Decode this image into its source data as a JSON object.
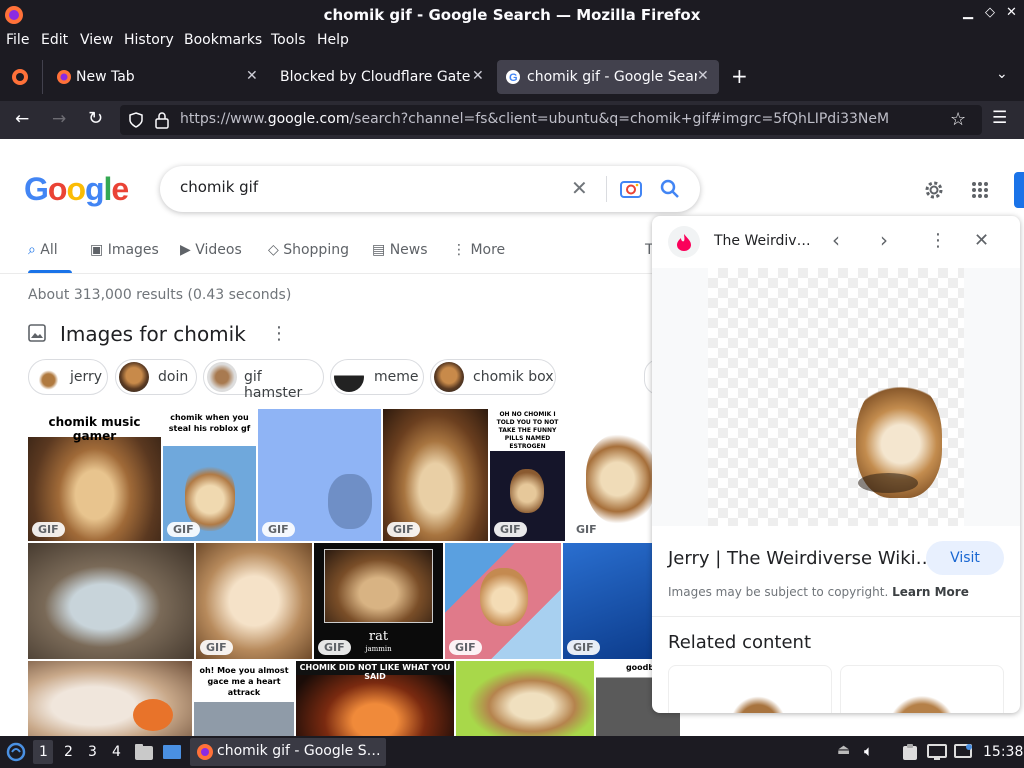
{
  "window": {
    "title": "chomik gif - Google Search — Mozilla Firefox"
  },
  "menu": [
    "File",
    "Edit",
    "View",
    "History",
    "Bookmarks",
    "Tools",
    "Help"
  ],
  "tabs": [
    {
      "label": "New Tab"
    },
    {
      "label": "Blocked by Cloudflare Gatew"
    },
    {
      "label": "chomik gif - Google Searc"
    }
  ],
  "url": {
    "scheme": "https://www.",
    "domain": "google.com",
    "path": "/search?channel=fs&client=ubuntu&q=chomik+gif#imgrc=5fQhLIPdi33NeM"
  },
  "google": {
    "logo": "Google",
    "query": "chomik gif",
    "tabs": [
      "All",
      "Images",
      "Videos",
      "Shopping",
      "News",
      "More"
    ],
    "extra_tab": "T",
    "result_stats": "About 313,000 results (0.43 seconds)",
    "images_heading": "Images for chomik",
    "chips": [
      "jerry",
      "doin",
      "gif hamster",
      "meme",
      "chomik box"
    ],
    "gif_badge": "GIF",
    "captions": {
      "music": "chomik music gamer",
      "roblox": "chomik when you steal his roblox gf",
      "estrogen": "OH NO CHOMIK I TOLD YOU TO NOT TAKE THE FUNNY PILLS NAMED ESTROGEN",
      "rat": "rat",
      "jammin": "jammin",
      "heart": "oh! Moe you almost gace me a heart attrack",
      "didnot": "CHOMIK DID NOT LIKE WHAT YOU SAID",
      "goodbye": "goodbye ch"
    }
  },
  "panel": {
    "source": "The Weirdiv…",
    "title": "Jerry | The Weirdiverse Wiki…",
    "visit": "Visit",
    "copyright": "Images may be subject to copyright.",
    "learn_more": "Learn More",
    "related": "Related content"
  },
  "taskbar": {
    "workspaces": [
      "1",
      "2",
      "3",
      "4"
    ],
    "app_label": "chomik gif - Google S…",
    "clock": "15:38"
  }
}
